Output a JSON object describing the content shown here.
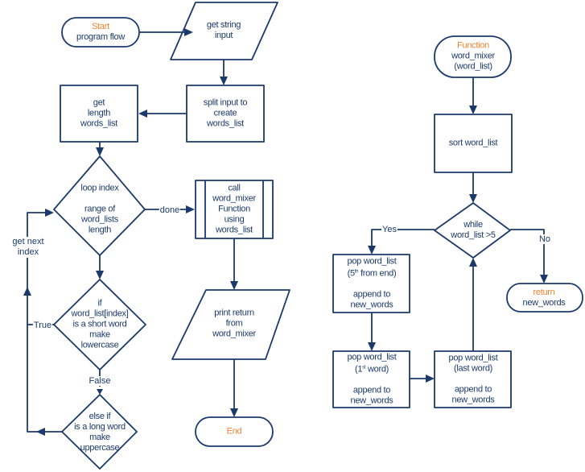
{
  "colors": {
    "line": "#1b3a6b",
    "accent": "#f58230",
    "background": "#ffffff"
  },
  "main_flow": {
    "start": {
      "accent": "Start",
      "text": "program flow"
    },
    "get_input": {
      "lines": [
        "get string",
        "input"
      ]
    },
    "split_input": {
      "lines": [
        "split input to",
        "create",
        "words_list"
      ]
    },
    "get_length": {
      "lines": [
        "get",
        "length",
        "words_list"
      ]
    },
    "loop_index": {
      "lines": [
        "loop index",
        "",
        "range of",
        "word_lists",
        "length"
      ]
    },
    "call_mixer": {
      "lines": [
        "call",
        "word_mixer",
        "Function",
        "using",
        "words_list"
      ]
    },
    "if_short": {
      "lines": [
        "if",
        "word_list[index]",
        "is a short word",
        "make",
        "lowercase"
      ]
    },
    "else_long": {
      "lines": [
        "else if",
        "is a long word",
        "make",
        "uppercase"
      ]
    },
    "print_return": {
      "lines": [
        "print return",
        "from",
        "word_mixer"
      ]
    },
    "end": {
      "accent": "End"
    },
    "edge_labels": {
      "done": "done",
      "get_next": "get next\nindex",
      "true": "True",
      "false": "False"
    }
  },
  "function_flow": {
    "start": {
      "accent": "Function",
      "lines": [
        "word_mixer",
        "(word_list)"
      ]
    },
    "sort": {
      "lines": [
        "sort word_list"
      ]
    },
    "while": {
      "lines": [
        "while",
        "word_list >5"
      ]
    },
    "pop_fifth": {
      "line1": "pop word_list",
      "line2_pre": "(5",
      "line2_sup": "th",
      "line2_post": " from end)",
      "line3": "append to",
      "line4": "new_words"
    },
    "pop_first": {
      "line1": "pop word_list",
      "line2_pre": "(1",
      "line2_sup": "st",
      "line2_post": " word)",
      "line3": "append to",
      "line4": "new_words"
    },
    "pop_last": {
      "lines": [
        "pop word_list",
        "(last word)",
        "",
        "append to",
        "new_words"
      ]
    },
    "return": {
      "accent": "return",
      "text": "new_words"
    },
    "edge_labels": {
      "yes": "Yes",
      "no": "No"
    }
  }
}
